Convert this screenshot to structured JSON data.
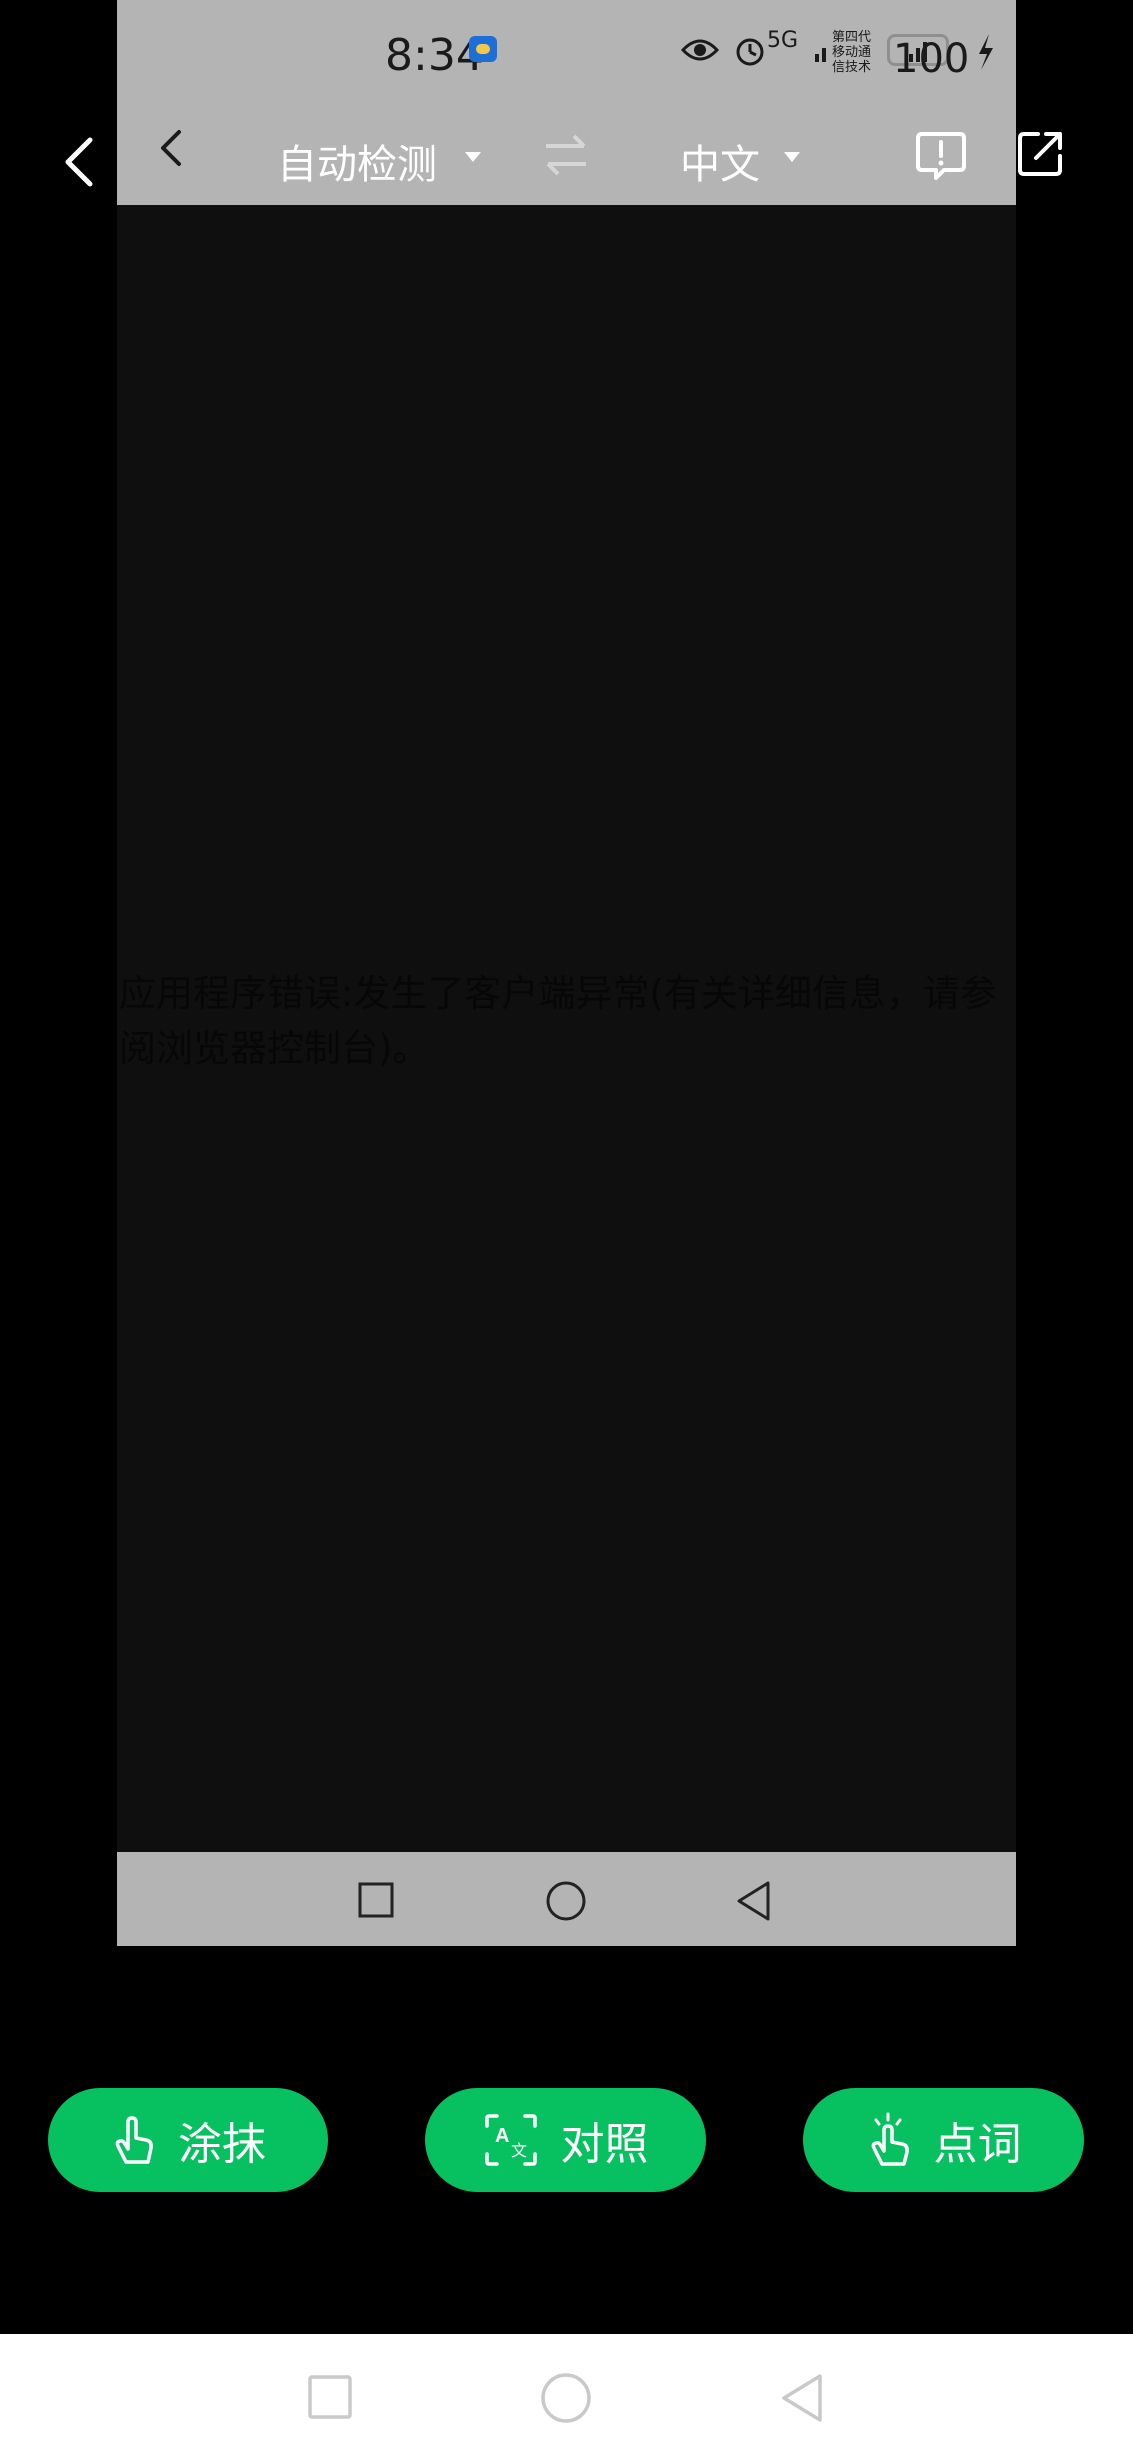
{
  "status_bar": {
    "time": "8:34",
    "network": "5G",
    "sim": "1\u0010",
    "network_secondary": "第四代 移动通 信技术",
    "battery": "100"
  },
  "translator_bar": {
    "source_language": "自动检测",
    "target_language": "中文"
  },
  "error_message": "应用程序错误:发生了客户端异常(有关详细信息，请参阅浏览器控制台)。",
  "actions": {
    "smear_label": "涂抹",
    "compare_label": "对照",
    "word_label": "点词"
  },
  "colors": {
    "accent": "#07c160",
    "screenshot_bar": "#b4b4b4",
    "background": "#000000"
  },
  "icons": [
    "back-arrow-icon",
    "caret-down-icon",
    "swap-icon",
    "feedback-icon",
    "share-icon",
    "square-icon",
    "circle-icon",
    "triangle-back-icon",
    "hand-pointer-icon",
    "translate-compare-icon",
    "tap-word-icon"
  ]
}
